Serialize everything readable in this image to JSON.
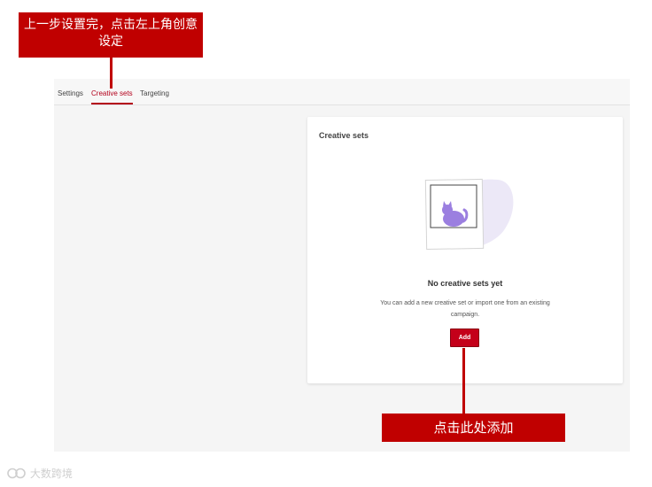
{
  "tabs": [
    {
      "label": "Settings",
      "active": false
    },
    {
      "label": "Creative sets",
      "active": true
    },
    {
      "label": "Targeting",
      "active": false
    }
  ],
  "card": {
    "title": "Creative sets",
    "empty_title": "No creative sets yet",
    "empty_desc": "You can add a new creative set or import one from an existing campaign.",
    "add_label": "Add"
  },
  "annotations": {
    "top": "上一步设置完，点击左上角创意设定",
    "bottom": "点击此处添加"
  },
  "watermark": "大数跨境",
  "colors": {
    "accent": "#b3001b",
    "callout": "#c00000",
    "illustration": "#9b7fe0"
  },
  "icons": {
    "illustration": "cat-photo-illustration",
    "watermark_logo": "logo-icon"
  }
}
